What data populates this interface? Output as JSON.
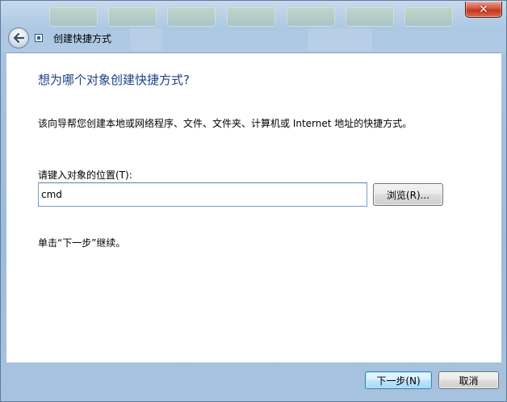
{
  "window": {
    "close_symbol": "✕"
  },
  "header": {
    "title": "创建快捷方式"
  },
  "content": {
    "heading": "想为哪个对象创建快捷方式?",
    "description": "该向导帮您创建本地或网络程序、文件、文件夹、计算机或 Internet 地址的快捷方式。",
    "location_label": "请键入对象的位置(T):",
    "location_value": "cmd",
    "browse_label": "浏览(R)...",
    "hint": "单击“下一步”继续。"
  },
  "footer": {
    "next_label": "下一步(N)",
    "cancel_label": "取消"
  },
  "colors": {
    "heading": "#1e3f87",
    "frame": "#a9c6e2",
    "close": "#c2361d"
  }
}
